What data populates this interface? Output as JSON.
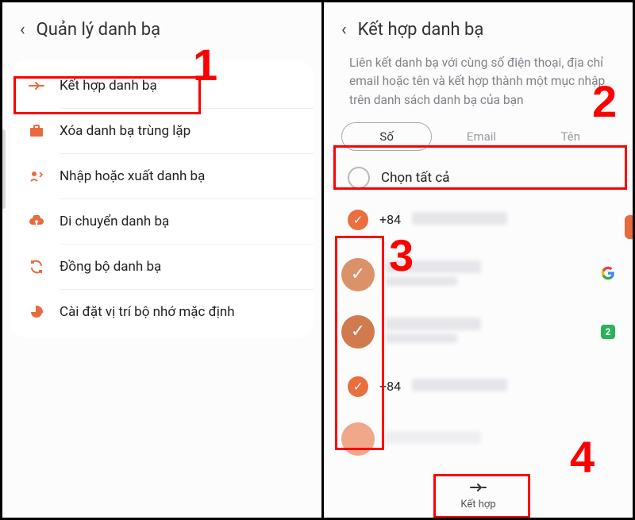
{
  "left": {
    "title": "Quản lý danh bạ",
    "items": [
      {
        "label": "Kết hợp danh bạ"
      },
      {
        "label": "Xóa danh bạ trùng lặp"
      },
      {
        "label": "Nhập hoặc xuất danh bạ"
      },
      {
        "label": "Di chuyển danh bạ"
      },
      {
        "label": "Đồng bộ danh bạ"
      },
      {
        "label": "Cài đặt vị trí bộ nhớ mặc định"
      }
    ]
  },
  "right": {
    "title": "Kết hợp danh bạ",
    "desc": "Liên kết danh bạ với cùng số điện thoại, địa chỉ email hoặc tên và kết hợp thành một mục nhập trên danh sách danh bạ của bạn",
    "tabs": {
      "so": "Số",
      "email": "Email",
      "ten": "Tên"
    },
    "select_all": "Chọn tất cả",
    "rows": {
      "r0_prefix": "+84",
      "r3_prefix": "+84"
    },
    "badge2": "2",
    "action": "Kết hợp"
  },
  "callouts": {
    "c1": "1",
    "c2": "2",
    "c3": "3",
    "c4": "4"
  }
}
